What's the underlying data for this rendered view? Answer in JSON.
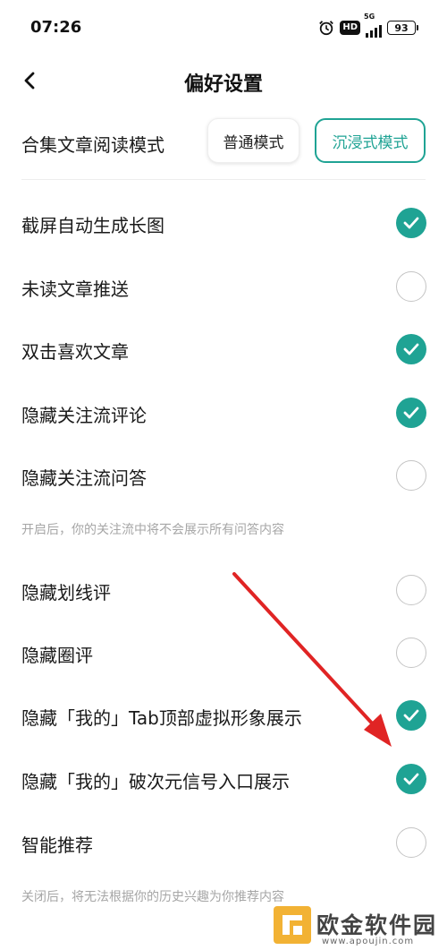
{
  "status_bar": {
    "time": "07:26",
    "hd": "HD",
    "network": "5G",
    "battery": "93"
  },
  "nav": {
    "title": "偏好设置",
    "back_icon": "chevron-left-icon"
  },
  "reading_mode": {
    "label": "合集文章阅读模式",
    "options": [
      "普通模式",
      "沉浸式模式"
    ],
    "selected": "沉浸式模式"
  },
  "settings": [
    {
      "label": "截屏自动生成长图",
      "checked": true
    },
    {
      "label": "未读文章推送",
      "checked": false
    },
    {
      "label": "双击喜欢文章",
      "checked": true
    },
    {
      "label": "隐藏关注流评论",
      "checked": true
    },
    {
      "label": "隐藏关注流问答",
      "checked": false
    },
    {
      "label": "隐藏划线评",
      "checked": false
    },
    {
      "label": "隐藏圈评",
      "checked": false
    },
    {
      "label": "隐藏「我的」Tab顶部虚拟形象展示",
      "checked": true
    },
    {
      "label": "隐藏「我的」破次元信号入口展示",
      "checked": true
    },
    {
      "label": "智能推荐",
      "checked": false
    }
  ],
  "hints": {
    "hide_qa": "开启后，你的关注流中将不会展示所有问答内容",
    "smart_recommend": "关闭后，将无法根据你的历史兴趣为你推荐内容"
  },
  "colors": {
    "accent": "#1fa394",
    "annotation_arrow": "#e02424"
  },
  "watermark": {
    "name": "欧金软件园",
    "url": "www.apoujin.com"
  }
}
